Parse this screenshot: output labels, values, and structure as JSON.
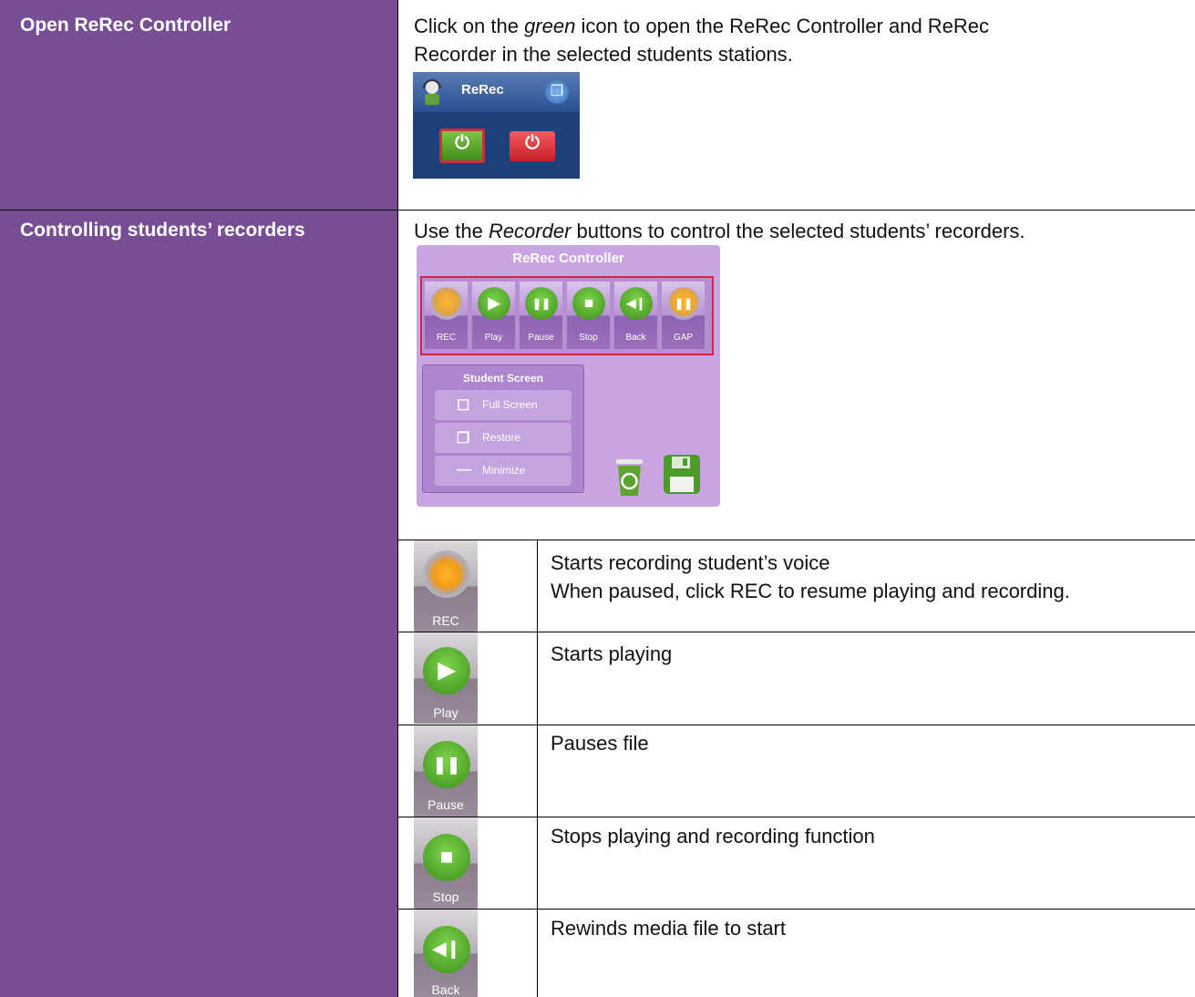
{
  "rows": [
    {
      "title": "Open ReRec Controller",
      "desc_parts": [
        "Click on the ",
        "green",
        " icon to open the ReRec Controller and ReRec",
        "Recorder in the selected students stations."
      ]
    },
    {
      "title": "Controlling students’ recorders",
      "desc_parts": [
        "Use the ",
        "Recorder",
        " buttons to control the selected students’ recorders."
      ]
    }
  ],
  "rerec_widget": {
    "title": "ReRec",
    "restore_icon": "restore-icon",
    "power_on_icon": "power-icon",
    "power_off_icon": "power-icon"
  },
  "controller": {
    "title": "ReRec Controller",
    "buttons": [
      {
        "label": "REC",
        "icon": "record-icon",
        "glyph": ""
      },
      {
        "label": "Play",
        "icon": "play-icon",
        "glyph": "▶"
      },
      {
        "label": "Pause",
        "icon": "pause-icon",
        "glyph": "❚❚"
      },
      {
        "label": "Stop",
        "icon": "stop-icon",
        "glyph": "■"
      },
      {
        "label": "Back",
        "icon": "rewind-icon",
        "glyph": "◀❙"
      },
      {
        "label": "GAP",
        "icon": "gap-icon",
        "glyph": "❚❚"
      }
    ],
    "student_screen": {
      "title": "Student Screen",
      "buttons": [
        {
          "label": "Full Screen",
          "icon": "fullscreen-icon",
          "glyph": "☐"
        },
        {
          "label": "Restore",
          "icon": "restore-icon",
          "glyph": "❐"
        },
        {
          "label": "Minimize",
          "icon": "minimize-icon",
          "glyph": "—"
        }
      ]
    }
  },
  "functions": [
    {
      "label": "REC",
      "glyph": "",
      "lines": [
        "Starts recording student’s voice",
        "When paused, click REC to resume playing and recording."
      ]
    },
    {
      "label": "Play",
      "glyph": "▶",
      "lines": [
        "Starts playing"
      ]
    },
    {
      "label": "Pause",
      "glyph": "❚❚",
      "lines": [
        "Pauses file"
      ]
    },
    {
      "label": "Stop",
      "glyph": "■",
      "lines": [
        "Stops playing and recording function"
      ]
    },
    {
      "label": "Back",
      "glyph": "◀❙",
      "lines": [
        "Rewinds media file to start"
      ]
    }
  ],
  "colors": {
    "left_col": "#774e93",
    "accent_red": "#d7263f"
  }
}
